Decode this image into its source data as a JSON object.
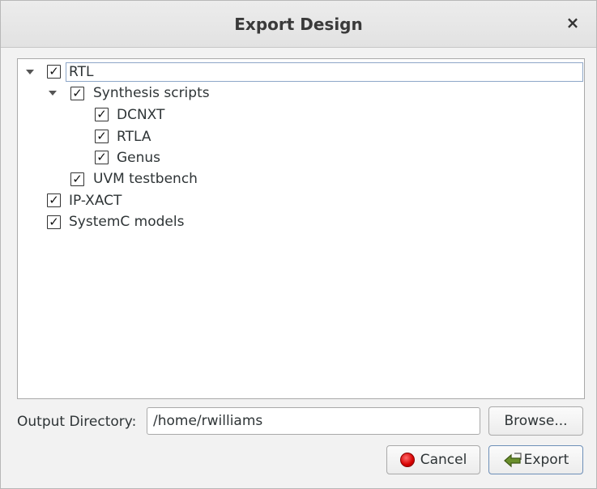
{
  "window": {
    "title": "Export Design",
    "close_glyph": "×"
  },
  "tree": {
    "items": [
      {
        "label": "RTL",
        "checked": true,
        "expanded": true,
        "selected": true
      },
      {
        "label": "Synthesis scripts",
        "checked": true,
        "expanded": true
      },
      {
        "label": "DCNXT",
        "checked": true
      },
      {
        "label": "RTLA",
        "checked": true
      },
      {
        "label": "Genus",
        "checked": true
      },
      {
        "label": "UVM testbench",
        "checked": true
      },
      {
        "label": "IP-XACT",
        "checked": true
      },
      {
        "label": "SystemC models",
        "checked": true
      }
    ],
    "check_glyph": "✓"
  },
  "output": {
    "label": "Output Directory:",
    "value": "/home/rwilliams"
  },
  "buttons": {
    "browse": "Browse...",
    "cancel": "Cancel",
    "export": "Export"
  },
  "icons": {
    "cancel": "stop-icon",
    "export": "export-arrow-icon"
  }
}
